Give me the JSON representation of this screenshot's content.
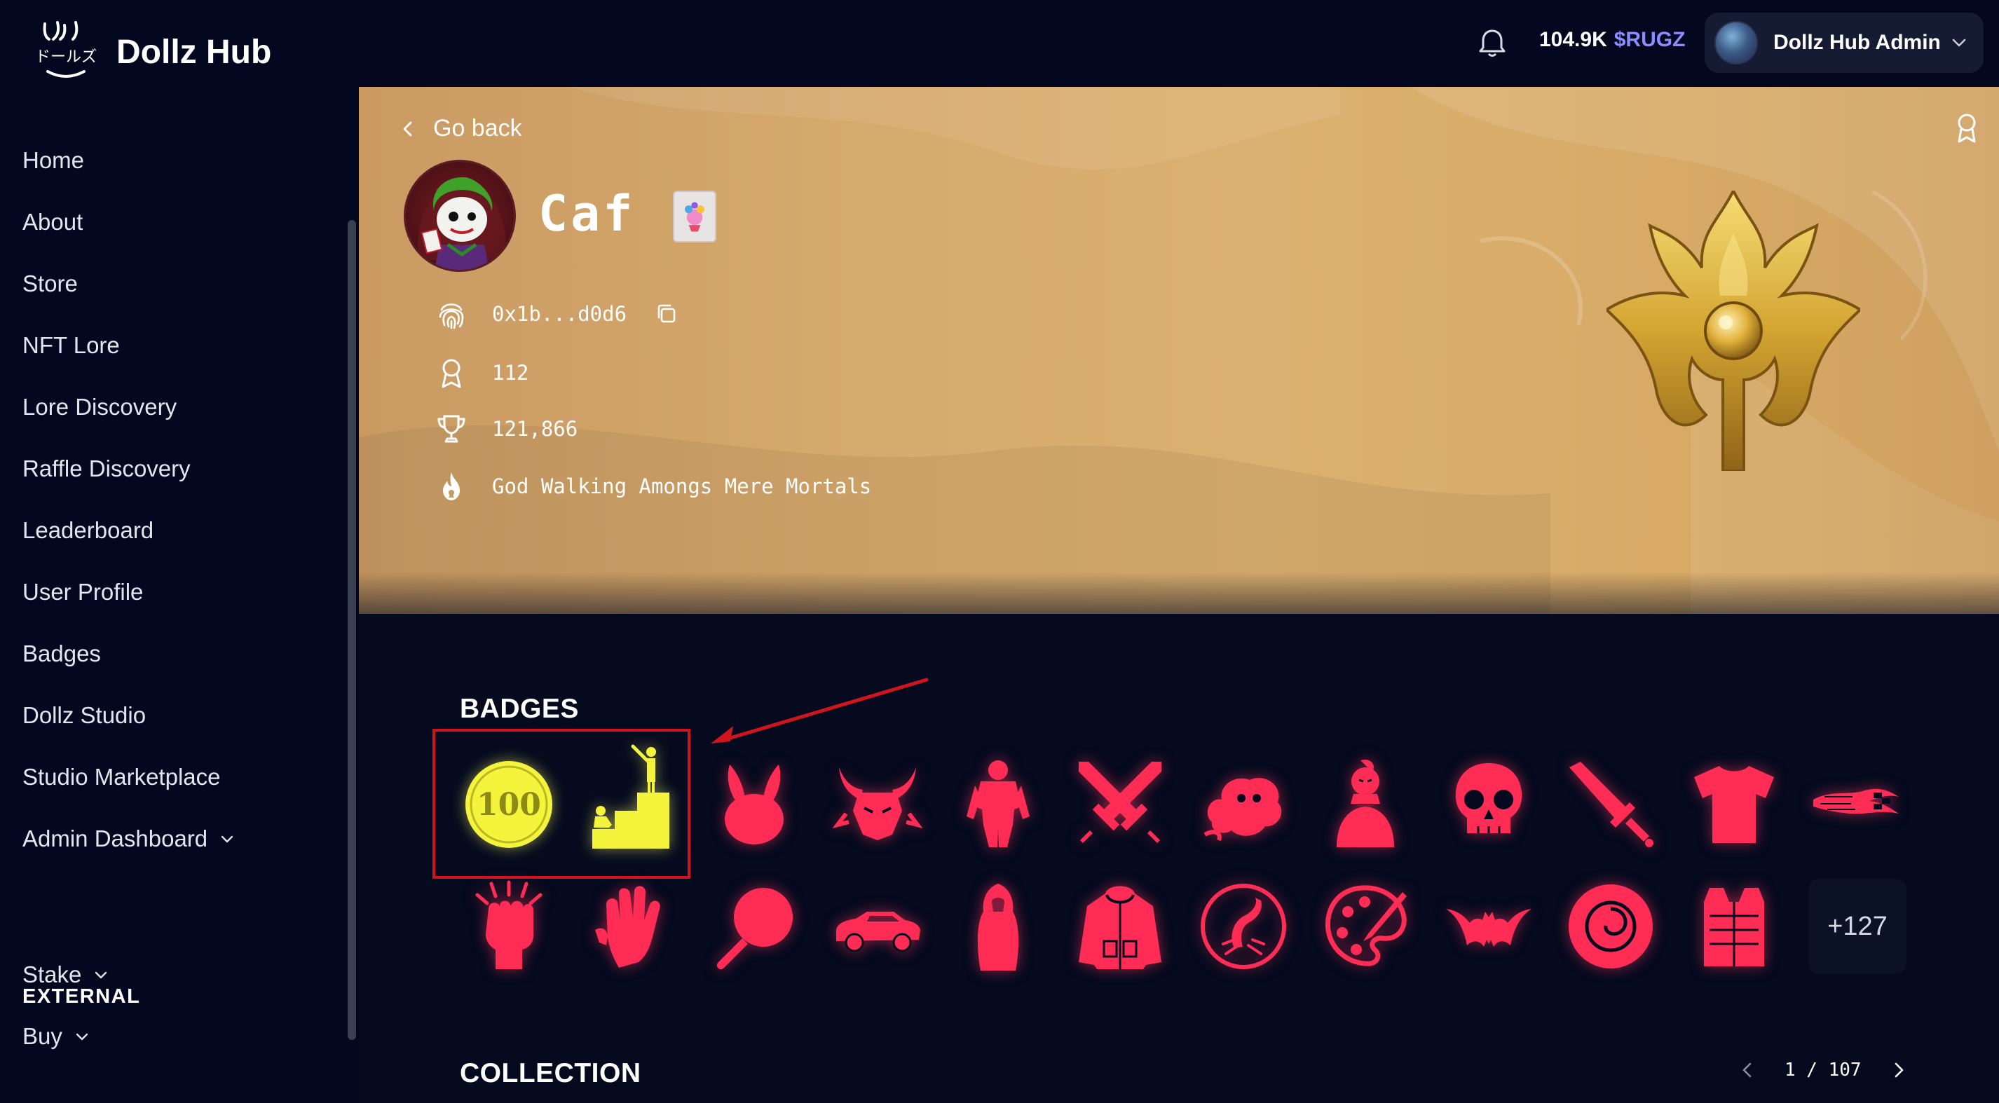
{
  "app": {
    "name": "Dollz Hub",
    "logo_text": "ドールズ"
  },
  "header": {
    "balance_amount": "104.9K",
    "balance_token": "$RUGZ",
    "user_name": "Dollz Hub Admin"
  },
  "sidebar": {
    "items": [
      {
        "label": "Home"
      },
      {
        "label": "About"
      },
      {
        "label": "Store"
      },
      {
        "label": "NFT Lore"
      },
      {
        "label": "Lore Discovery"
      },
      {
        "label": "Raffle Discovery"
      },
      {
        "label": "Leaderboard"
      },
      {
        "label": "User Profile"
      },
      {
        "label": "Badges"
      },
      {
        "label": "Dollz Studio"
      },
      {
        "label": "Studio Marketplace"
      },
      {
        "label": "Admin Dashboard",
        "has_submenu": true
      }
    ],
    "external_label": "EXTERNAL",
    "external_items": [
      {
        "label": "Stake",
        "has_submenu": true
      },
      {
        "label": "Buy",
        "has_submenu": true
      }
    ]
  },
  "profile": {
    "go_back": "Go back",
    "name": "Caf",
    "wallet": "0x1b...d0d6",
    "badge_count": "112",
    "score": "121,866",
    "rank_title": "God Walking Amongs Mere Mortals"
  },
  "badges": {
    "title": "BADGES",
    "highlighted": [
      "100-coin-badge",
      "podium-badge"
    ],
    "row1": [
      "100-coin-icon",
      "podium-icon",
      "bunny-icon",
      "horned-demon-icon",
      "armored-giant-icon",
      "crossed-swords-icon",
      "spirit-creature-icon",
      "warrior-bust-icon",
      "skull-icon",
      "broadsword-icon",
      "tshirt-icon",
      "checkered-flag-flames-icon"
    ],
    "row2": [
      "raised-fist-icon",
      "glove-icon",
      "frying-pan-icon",
      "car-icon",
      "hooded-cloak-icon",
      "hoodie-icon",
      "scorpion-icon",
      "palette-icon",
      "bat-icon",
      "vortex-icon",
      "vest-icon"
    ],
    "more_label": "+127",
    "colors": {
      "red": "#ff2d55",
      "yellow": "#f4f43c"
    }
  },
  "collection": {
    "title": "COLLECTION",
    "page": "1 / 107"
  }
}
